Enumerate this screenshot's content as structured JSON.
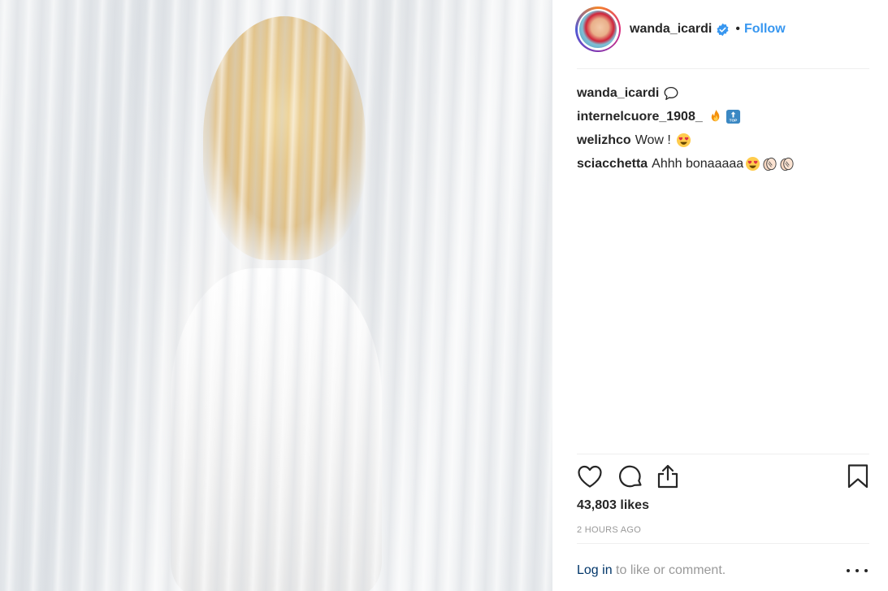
{
  "post": {
    "username": "wanda_icardi",
    "separator": "•",
    "follow_label": "Follow"
  },
  "comments": [
    {
      "user": "wanda_icardi",
      "text": "",
      "emojis": [
        "speech-bubble-icon"
      ]
    },
    {
      "user": "internelcuore_1908_",
      "text": "",
      "emojis": [
        "fire-emoji",
        "top-arrow-emoji"
      ]
    },
    {
      "user": "welizhco",
      "text": "Wow !",
      "emojis": [
        "heart-eyes-emoji"
      ]
    },
    {
      "user": "sciacchetta",
      "text": "Ahhh bonaaaaa",
      "emojis": [
        "heart-eyes-emoji",
        "clapping-hands-emoji",
        "clapping-hands-emoji"
      ]
    }
  ],
  "actions": {
    "like_icon": "heart-icon",
    "comment_icon": "comment-icon",
    "share_icon": "share-icon",
    "save_icon": "bookmark-icon"
  },
  "likes_text": "43,803 likes",
  "timestamp": "2 HOURS AGO",
  "login": {
    "link": "Log in",
    "rest": "to like or comment."
  },
  "colors": {
    "follow": "#3897f0",
    "verified": "#3897f0",
    "muted": "#999999",
    "login_link": "#003569"
  }
}
